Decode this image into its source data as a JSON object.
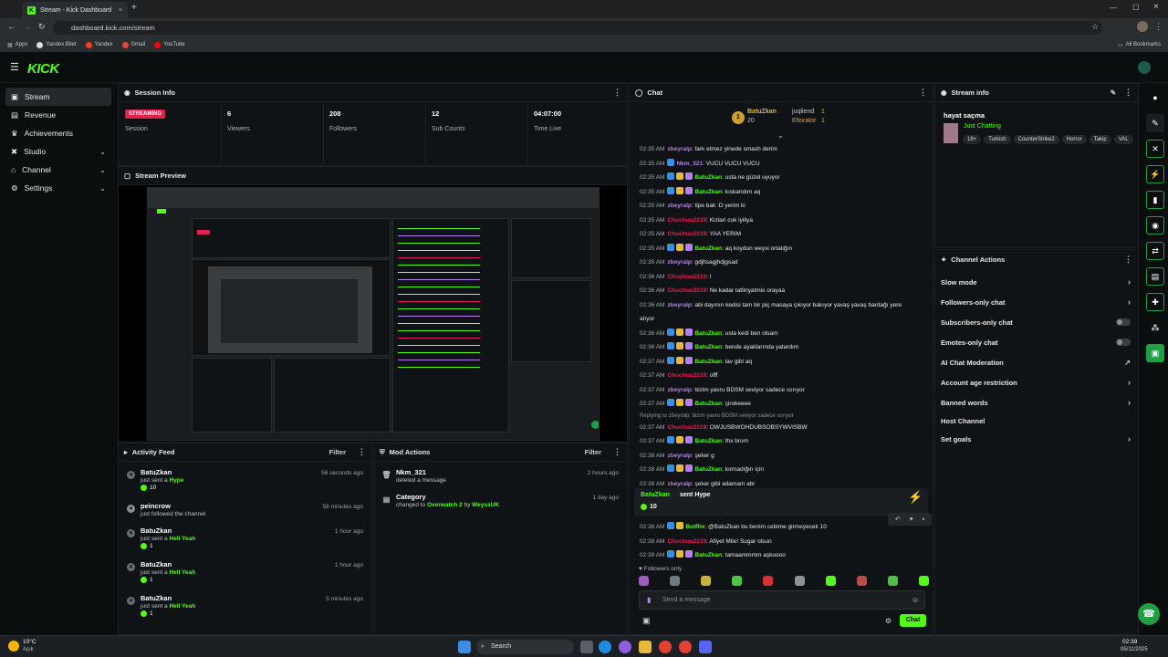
{
  "browser": {
    "tab_title": "Stream - Kick Dashboard",
    "url": "dashboard.kick.com/stream",
    "bookmarks": [
      "Apps",
      "Yandex.Bilet",
      "Yandex",
      "Gmail",
      "YouTube"
    ],
    "all_bookmarks": "All Bookmarks"
  },
  "app": {
    "logo": "KICK"
  },
  "sidebar": {
    "items": [
      {
        "label": "Stream",
        "icon": "broadcast-icon"
      },
      {
        "label": "Revenue",
        "icon": "wallet-icon"
      },
      {
        "label": "Achievements",
        "icon": "trophy-icon"
      },
      {
        "label": "Studio",
        "icon": "studio-icon"
      },
      {
        "label": "Channel",
        "icon": "channel-icon"
      },
      {
        "label": "Settings",
        "icon": "gear-icon"
      }
    ]
  },
  "session": {
    "title": "Session Info",
    "status": "STREAMING",
    "status_label": "Session",
    "stats": [
      {
        "value": "6",
        "label": "Viewers"
      },
      {
        "value": "208",
        "label": "Followers"
      },
      {
        "value": "12",
        "label": "Sub Counts"
      },
      {
        "value": "04:07:00",
        "label": "Time Live"
      }
    ]
  },
  "preview": {
    "title": "Stream Preview"
  },
  "activity": {
    "title": "Activity Feed",
    "filter": "Filter",
    "items": [
      {
        "name": "BatuZkan",
        "pre": "just sent a",
        "gift": "Hype",
        "amount": "10",
        "time": "56 seconds ago"
      },
      {
        "name": "peincrow",
        "pre": "just followed the channel",
        "gift": "",
        "amount": "",
        "time": "58 minutes ago"
      },
      {
        "name": "BatuZkan",
        "pre": "just sent a",
        "gift": "Hell Yeah",
        "amount": "1",
        "time": "1 hour ago"
      },
      {
        "name": "BatuZkan",
        "pre": "just sent a",
        "gift": "Hell Yeah",
        "amount": "1",
        "time": "1 hour ago"
      },
      {
        "name": "BatuZkan",
        "pre": "just sent a",
        "gift": "Hell Yeah",
        "amount": "1",
        "time": "5 minutes ago"
      }
    ]
  },
  "mod": {
    "title": "Mod Actions",
    "filter": "Filter",
    "items": [
      {
        "name": "Nkm_321",
        "desc": "deleted a message",
        "time": "2 hours ago"
      },
      {
        "name": "Category",
        "desc": "changed to",
        "target": "Overwatch 2",
        "by": "by",
        "actor": "WeyssUK",
        "time": "1 day ago"
      }
    ]
  },
  "chat": {
    "title": "Chat",
    "top": {
      "leader": "BatuZkan",
      "leader_count": "20",
      "second": "juqliend",
      "second_count": "1",
      "third": "Eltorator",
      "third_count": "1"
    },
    "messages": [
      {
        "time": "02:35 AM",
        "user": "zbeyralp",
        "text": ": fark etmez yinede smash derim",
        "color": "#b67ef0",
        "badges": 0
      },
      {
        "time": "02:35 AM",
        "user": "Nkm_321",
        "text": ": VUCU VUCU VUCU",
        "color": "#b67ef0",
        "badges": 1
      },
      {
        "time": "02:35 AM",
        "user": "BatuZkan",
        "text": ": usta ne güzel uyuyor",
        "color": "#53fc18",
        "badges": 3
      },
      {
        "time": "02:35 AM",
        "user": "BatuZkan",
        "text": ": kıskandım aq",
        "color": "#53fc18",
        "badges": 3
      },
      {
        "time": "02:35 AM",
        "user": "zbeyralp",
        "text": ": tipe bak :D yerim ki",
        "color": "#b67ef0",
        "badges": 0
      },
      {
        "time": "02:35 AM",
        "user": "Chuchuu2219",
        "text": ": Kizlari cok iyiliya",
        "color": "#e0234e",
        "badges": 0
      },
      {
        "time": "02:35 AM",
        "user": "Chuchuu2219",
        "text": ": YAA YERIM",
        "color": "#e0234e",
        "badges": 0
      },
      {
        "time": "02:35 AM",
        "user": "BatuZkan",
        "text": ": aq koydun weysi ortalığın",
        "color": "#53fc18",
        "badges": 3
      },
      {
        "time": "02:35 AM",
        "user": "zbeyralp",
        "text": ": gdjhsagjhdjgsad",
        "color": "#b67ef0",
        "badges": 0
      },
      {
        "time": "02:36 AM",
        "user": "Chuchuu2219",
        "text": ": l",
        "color": "#e0234e",
        "badges": 0
      },
      {
        "time": "02:36 AM",
        "user": "Chuchuu2219",
        "text": ": Ne kadar tatlinyatmis orayaa",
        "color": "#e0234e",
        "badges": 0
      },
      {
        "time": "02:36 AM",
        "user": "zbeyralp",
        "text": ": abi dayının kedisi tam bir piç masaya çıkıyor bakıyor yavaş yavaş bardağı yere",
        "color": "#b67ef0",
        "badges": 0
      },
      {
        "time": "",
        "user": "",
        "text": "atıyor",
        "color": "#e8e8e8",
        "badges": 0
      },
      {
        "time": "02:36 AM",
        "user": "BatuZkan",
        "text": ": usta kedi ben olsam",
        "color": "#53fc18",
        "badges": 3
      },
      {
        "time": "02:36 AM",
        "user": "BatuZkan",
        "text": ": bende ayaklarında yatardım",
        "color": "#53fc18",
        "badges": 3
      },
      {
        "time": "02:37 AM",
        "user": "BatuZkan",
        "text": ": lav gibi aq",
        "color": "#53fc18",
        "badges": 3
      },
      {
        "time": "02:37 AM",
        "user": "Chuchuu2219",
        "text": ": offf",
        "color": "#e0234e",
        "badges": 0
      },
      {
        "time": "02:37 AM",
        "user": "zbeyralp",
        "text": ": bizim yavru BDSM seviyor sadece ısırıyor",
        "color": "#b67ef0",
        "badges": 0
      },
      {
        "time": "02:37 AM",
        "user": "BatuZkan",
        "text": ": çirokeeee",
        "color": "#53fc18",
        "badges": 3
      }
    ],
    "reply_hint": "Replying to zbeyralp: bizim yavru BDSM seviyor sadece ısırıyor",
    "messages2": [
      {
        "time": "02:37 AM",
        "user": "Chuchuu2219",
        "text": ": OWJUSBWOHDUBSOBSYWVISBW",
        "color": "#e0234e",
        "badges": 0
      },
      {
        "time": "02:37 AM",
        "user": "BatuZkan",
        "text": ": thx brom",
        "color": "#53fc18",
        "badges": 3
      },
      {
        "time": "02:38 AM",
        "user": "zbeyralp",
        "text": ": şeker g",
        "color": "#b67ef0",
        "badges": 0
      },
      {
        "time": "02:38 AM",
        "user": "BatuZkan",
        "text": ": kırmadığın için",
        "color": "#53fc18",
        "badges": 3
      },
      {
        "time": "02:38 AM",
        "user": "zbeyralp",
        "text": ": şeker gibi adamam abi",
        "color": "#b67ef0",
        "badges": 0
      }
    ],
    "gift_banner": {
      "user": "BatuZkan",
      "text": "sent Hype",
      "amount": "10"
    },
    "messages3": [
      {
        "time": "02:38 AM",
        "user": "BotRix",
        "text": ": @BatuZkan bu benim cebime girmeyecek 10",
        "color": "#53fc18",
        "badges": 2
      },
      {
        "time": "02:38 AM",
        "user": "Chuchuu2219",
        "text": ": Afiyet Mile! Sugar olsun",
        "color": "#e0234e",
        "badges": 0
      },
      {
        "time": "02:39 AM",
        "user": "BatuZkan",
        "text": ": tamaammmm aşkoooo",
        "color": "#53fc18",
        "badges": 3
      }
    ],
    "followers_only": "Followers only",
    "placeholder": "Send a message",
    "send": "Chat"
  },
  "stream_info": {
    "title": "Stream info",
    "stream_title": "hayat saçma",
    "category": "Just Chatting",
    "tags": [
      "18+",
      "Turkish",
      "CounterStrike2",
      "Horror",
      "Takip",
      "VAL"
    ]
  },
  "actions": {
    "title": "Channel Actions",
    "items": [
      {
        "label": "Slow mode",
        "kind": "chevron"
      },
      {
        "label": "Followers-only chat",
        "kind": "chevron"
      },
      {
        "label": "Subscribers-only chat",
        "kind": "toggle"
      },
      {
        "label": "Emotes-only chat",
        "kind": "toggle"
      },
      {
        "label": "AI Chat Moderation",
        "kind": "external"
      },
      {
        "label": "Account age restriction",
        "kind": "chevron"
      },
      {
        "label": "Banned words",
        "kind": "chevron"
      },
      {
        "label": "Host Channel",
        "kind": "none"
      },
      {
        "label": "Set goals",
        "kind": "chevron"
      }
    ]
  },
  "taskbar": {
    "weather": "10°C",
    "weather_desc": "Açık",
    "search": "Search",
    "time": "02:39",
    "date": "05/11/2025"
  },
  "colors": {
    "accent": "#53fc18",
    "live": "#e0234e",
    "sub": "#b67ef0",
    "bg": "#0b0e0f"
  }
}
